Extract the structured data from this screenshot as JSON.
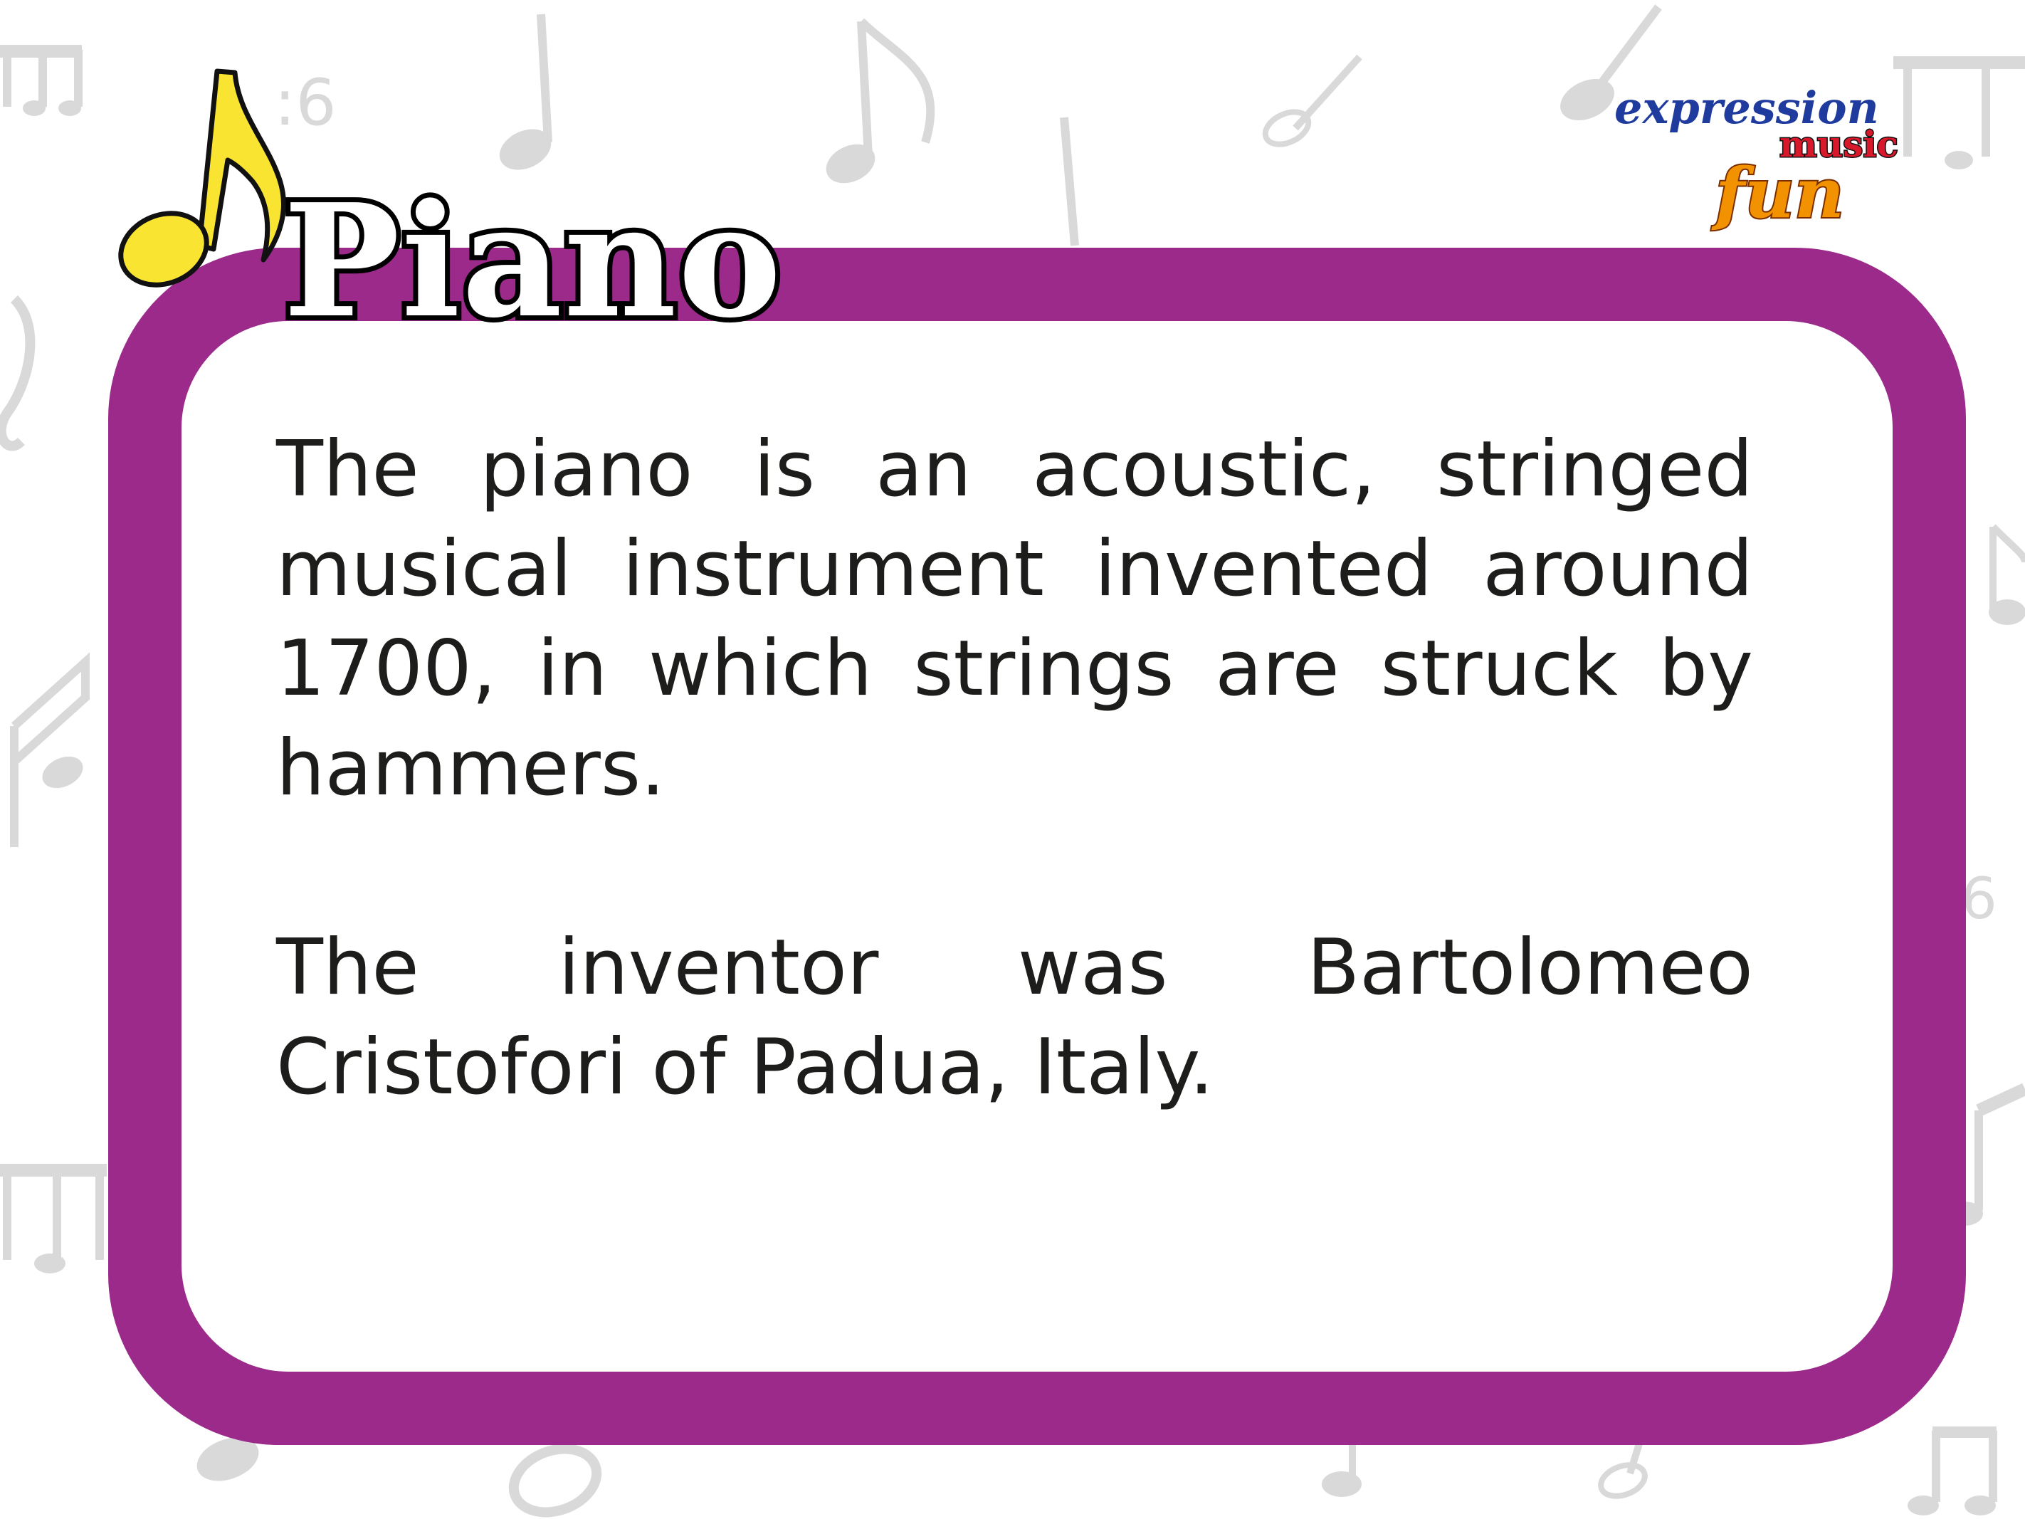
{
  "title": "Piano",
  "paragraphs": [
    "The piano is an acoustic, stringed musical instrument invented around 1700, in which strings are struck by hammers.",
    "The inventor was Bartolomeo Cristofori of Padua, Italy."
  ],
  "logo": {
    "word1": "expression",
    "word2": "music",
    "word3": "fun"
  },
  "colors": {
    "frame": "#9b2a8a",
    "note_yellow": "#f9e531",
    "text": "#1d1d1b",
    "background_notes": "#d9d9d9",
    "logo_blue": "#1f3b9e",
    "logo_red": "#d7192b",
    "logo_orange": "#f39200"
  },
  "icons": [
    "eighth-note-icon",
    "background-music-notes"
  ]
}
